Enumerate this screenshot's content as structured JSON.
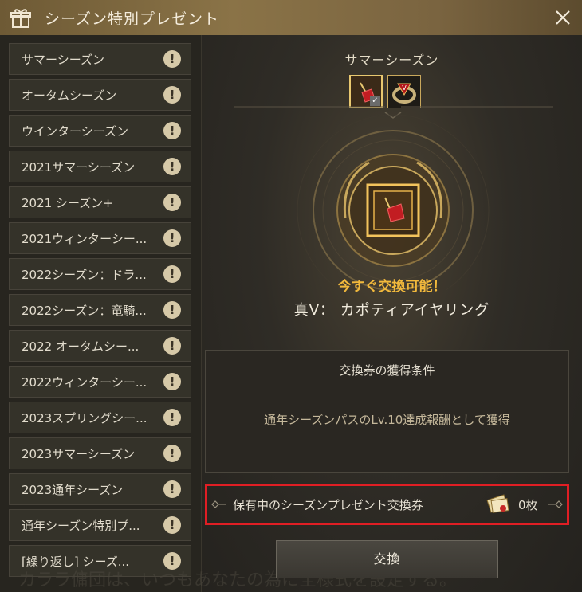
{
  "window": {
    "title": "シーズン特別プレゼント",
    "title_icon": "gift-icon",
    "close_icon": "close-icon"
  },
  "sidebar": {
    "items": [
      {
        "label": "サマーシーズン",
        "badge": "!"
      },
      {
        "label": "オータムシーズン",
        "badge": "!"
      },
      {
        "label": "ウインターシーズン",
        "badge": "!"
      },
      {
        "label": "2021サマーシーズン",
        "badge": "!"
      },
      {
        "label": "2021 シーズン+",
        "badge": "!"
      },
      {
        "label": "2021ウィンターシー...",
        "badge": "!"
      },
      {
        "label": "2022シーズン：ドラ...",
        "badge": "!"
      },
      {
        "label": "2022シーズン：竜騎...",
        "badge": "!"
      },
      {
        "label": "2022 オータムシー...",
        "badge": "!"
      },
      {
        "label": "2022ウィンターシー...",
        "badge": "!"
      },
      {
        "label": "2023スプリングシー...",
        "badge": "!"
      },
      {
        "label": "2023サマーシーズン",
        "badge": "!"
      },
      {
        "label": "2023通年シーズン",
        "badge": "!"
      },
      {
        "label": "通年シーズン特別プ...",
        "badge": "!"
      },
      {
        "label": "[繰り返し] シーズ...",
        "badge": "!"
      }
    ]
  },
  "main": {
    "season_title": "サマーシーズン",
    "available_text": "今すぐ交換可能！",
    "item_name": "真V： カポティアイヤリング",
    "condition": {
      "title": "交換券の獲得条件",
      "text": "通年シーズンパスのLv.10達成報酬として獲得"
    },
    "ticket": {
      "label": "保有中のシーズンプレゼント交換券",
      "count": "0枚"
    },
    "exchange_button": "交換",
    "background_text": "カララ傭団は、いつもあなたの為に全様式を設定する。"
  },
  "colors": {
    "accent_gold": "#f2b93c",
    "highlight_red": "#e01e24",
    "title_bar": "#8a7347"
  }
}
